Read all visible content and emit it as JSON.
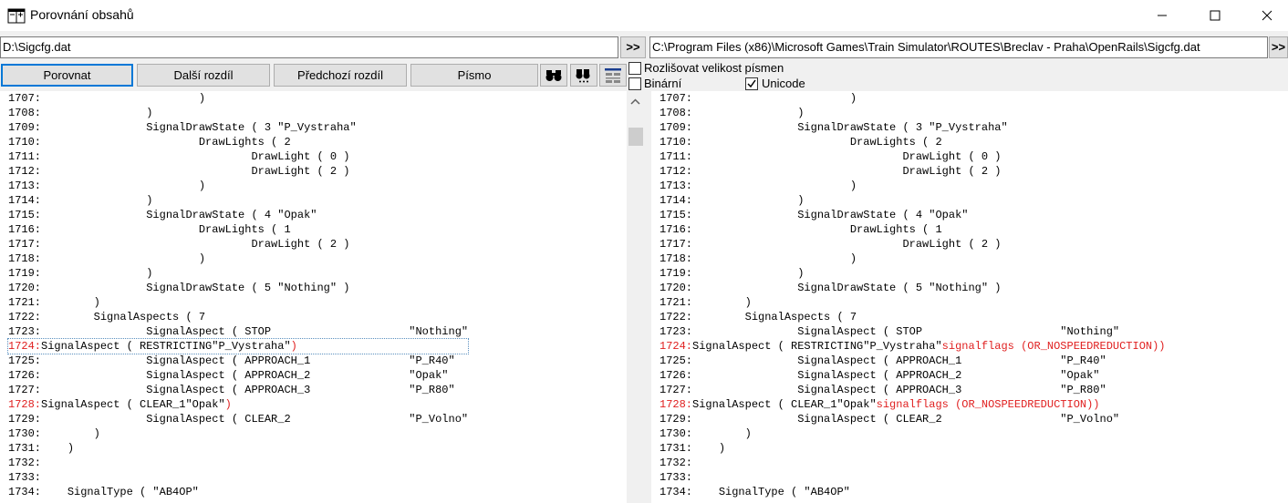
{
  "window": {
    "title": "Porovnání obsahů"
  },
  "left": {
    "path": "D:\\Sigcfg.dat",
    "copy_label": ">>",
    "lines": [
      {
        "n": "1707:",
        "t": "                        )"
      },
      {
        "n": "1708:",
        "t": "                )"
      },
      {
        "n": "1709:",
        "t": "                SignalDrawState ( 3 \"P_Vystraha\""
      },
      {
        "n": "1710:",
        "t": "                        DrawLights ( 2"
      },
      {
        "n": "1711:",
        "t": "                                DrawLight ( 0 )"
      },
      {
        "n": "1712:",
        "t": "                                DrawLight ( 2 )"
      },
      {
        "n": "1713:",
        "t": "                        )"
      },
      {
        "n": "1714:",
        "t": "                )"
      },
      {
        "n": "1715:",
        "t": "                SignalDrawState ( 4 \"Opak\""
      },
      {
        "n": "1716:",
        "t": "                        DrawLights ( 1"
      },
      {
        "n": "1717:",
        "t": "                                DrawLight ( 2 )"
      },
      {
        "n": "1718:",
        "t": "                        )"
      },
      {
        "n": "1719:",
        "t": "                )"
      },
      {
        "n": "1720:",
        "t": "                SignalDrawState ( 5 \"Nothing\" )"
      },
      {
        "n": "1721:",
        "t": "        )"
      },
      {
        "n": "1722:",
        "t": "        SignalAspects ( 7"
      },
      {
        "n": "1723:",
        "t": "                SignalAspect ( STOP                     \"Nothing\""
      },
      {
        "n": "1724:",
        "t": "SignalAspect ( RESTRICTING\"P_Vystraha\"",
        "red": ")",
        "diff": true,
        "cur": true
      },
      {
        "n": "1725:",
        "t": "                SignalAspect ( APPROACH_1               \"P_R40\""
      },
      {
        "n": "1726:",
        "t": "                SignalAspect ( APPROACH_2               \"Opak\""
      },
      {
        "n": "1727:",
        "t": "                SignalAspect ( APPROACH_3               \"P_R80\""
      },
      {
        "n": "1728:",
        "t": "SignalAspect ( CLEAR_1\"Opak\"",
        "red": ")",
        "diff": true
      },
      {
        "n": "1729:",
        "t": "                SignalAspect ( CLEAR_2                  \"P_Volno\""
      },
      {
        "n": "1730:",
        "t": "        )"
      },
      {
        "n": "1731:",
        "t": "    )"
      },
      {
        "n": "1732:",
        "t": ""
      },
      {
        "n": "1733:",
        "t": ""
      },
      {
        "n": "1734:",
        "t": "    SignalType ( \"AB4OP\""
      }
    ]
  },
  "right": {
    "path": "C:\\Program Files (x86)\\Microsoft Games\\Train Simulator\\ROUTES\\Breclav - Praha\\OpenRails\\Sigcfg.dat",
    "copy_label": ">>",
    "lines": [
      {
        "n": "1707:",
        "t": "                        )"
      },
      {
        "n": "1708:",
        "t": "                )"
      },
      {
        "n": "1709:",
        "t": "                SignalDrawState ( 3 \"P_Vystraha\""
      },
      {
        "n": "1710:",
        "t": "                        DrawLights ( 2"
      },
      {
        "n": "1711:",
        "t": "                                DrawLight ( 0 )"
      },
      {
        "n": "1712:",
        "t": "                                DrawLight ( 2 )"
      },
      {
        "n": "1713:",
        "t": "                        )"
      },
      {
        "n": "1714:",
        "t": "                )"
      },
      {
        "n": "1715:",
        "t": "                SignalDrawState ( 4 \"Opak\""
      },
      {
        "n": "1716:",
        "t": "                        DrawLights ( 1"
      },
      {
        "n": "1717:",
        "t": "                                DrawLight ( 2 )"
      },
      {
        "n": "1718:",
        "t": "                        )"
      },
      {
        "n": "1719:",
        "t": "                )"
      },
      {
        "n": "1720:",
        "t": "                SignalDrawState ( 5 \"Nothing\" )"
      },
      {
        "n": "1721:",
        "t": "        )"
      },
      {
        "n": "1722:",
        "t": "        SignalAspects ( 7"
      },
      {
        "n": "1723:",
        "t": "                SignalAspect ( STOP                     \"Nothing\""
      },
      {
        "n": "1724:",
        "t": "SignalAspect ( RESTRICTING\"P_Vystraha\"",
        "red": "signalflags (OR_NOSPEEDREDUCTION))",
        "diff": true
      },
      {
        "n": "1725:",
        "t": "                SignalAspect ( APPROACH_1               \"P_R40\""
      },
      {
        "n": "1726:",
        "t": "                SignalAspect ( APPROACH_2               \"Opak\""
      },
      {
        "n": "1727:",
        "t": "                SignalAspect ( APPROACH_3               \"P_R80\""
      },
      {
        "n": "1728:",
        "t": "SignalAspect ( CLEAR_1\"Opak\"",
        "red": "signalflags (OR_NOSPEEDREDUCTION))",
        "diff": true
      },
      {
        "n": "1729:",
        "t": "                SignalAspect ( CLEAR_2                  \"P_Volno\""
      },
      {
        "n": "1730:",
        "t": "        )"
      },
      {
        "n": "1731:",
        "t": "    )"
      },
      {
        "n": "1732:",
        "t": ""
      },
      {
        "n": "1733:",
        "t": ""
      },
      {
        "n": "1734:",
        "t": "    SignalType ( \"AB4OP\""
      }
    ]
  },
  "toolbar": {
    "compare": "Porovnat",
    "next_diff": "Další rozdíl",
    "prev_diff": "Předchozí rozdíl",
    "font": "Písmo",
    "icons": [
      "find-icon",
      "find-next-icon",
      "format-icon"
    ]
  },
  "options": {
    "case_sensitive": {
      "label": "Rozlišovat velikost písmen",
      "checked": false
    },
    "binary": {
      "label": "Binární",
      "checked": false
    },
    "unicode": {
      "label": "Unicode",
      "checked": true
    }
  },
  "colors": {
    "diff": "#e02020",
    "focus": "#0078d7"
  }
}
